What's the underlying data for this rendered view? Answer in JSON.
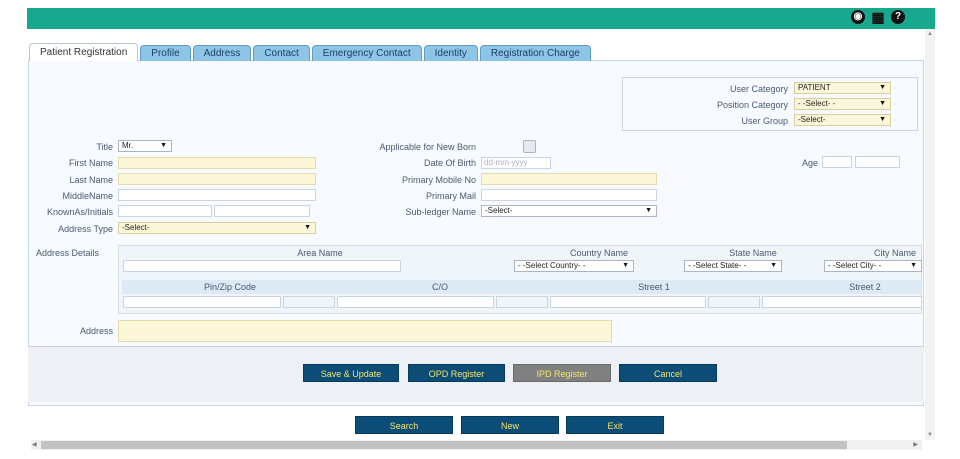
{
  "tabs": [
    "Patient Registration",
    "Profile",
    "Address",
    "Contact",
    "Emergency Contact",
    "Identity",
    "Registration Charge"
  ],
  "user": {
    "category_label": "User Category",
    "category_value": "PATIENT",
    "position_label": "Position Category",
    "position_value": "- -Select- -",
    "group_label": "User Group",
    "group_value": "-Select-"
  },
  "form": {
    "title_label": "Title",
    "title_value": "Mr.",
    "first_name_label": "First Name",
    "last_name_label": "Last Name",
    "middle_name_label": "MiddleName",
    "known_as_label": "KnownAs/Initials",
    "address_type_label": "Address Type",
    "address_type_value": "-Select-",
    "newborn_label": "Applicable for New Born",
    "dob_label": "Date Of Birth",
    "dob_placeholder": "dd-mm-yyyy",
    "mobile_label": "Primary Mobile No",
    "mail_label": "Primary Mail",
    "subledger_label": "Sub-ledger Name",
    "subledger_value": "-Select-",
    "age_label": "Age"
  },
  "address_details": {
    "label": "Address Details",
    "area_name": "Area Name",
    "country_name": "Country Name",
    "country_value": "- -Select Country- -",
    "state_name": "State Name",
    "state_value": "- -Select State- -",
    "city_name": "City Name",
    "city_value": "- -Select City- -",
    "pin": "Pin/Zip Code",
    "co": "C/O",
    "street1": "Street 1",
    "street2": "Street 2",
    "address_label": "Address"
  },
  "actions": {
    "save": "Save & Update",
    "opd": "OPD Register",
    "ipd": "IPD Register",
    "cancel": "Cancel",
    "search": "Search",
    "new": "New",
    "exit": "Exit"
  },
  "icons": [
    "settings-icon",
    "grid-icon",
    "help-icon"
  ],
  "colors": {
    "header": "#17a88e",
    "button": "#0c4d78",
    "button_text": "#f5e36a",
    "tab": "#8ec5e6"
  }
}
